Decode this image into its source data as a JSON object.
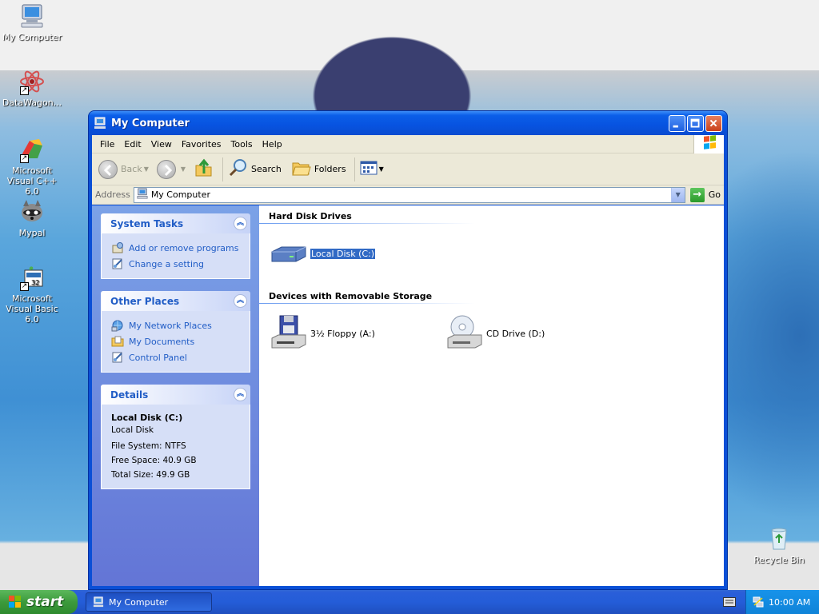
{
  "desktop": {
    "icons": [
      {
        "label": "My Computer"
      },
      {
        "label": "DataWagon..."
      },
      {
        "label": "Microsoft Visual C++ 6.0"
      },
      {
        "label": "Mypal"
      },
      {
        "label": "Microsoft Visual Basic 6.0"
      },
      {
        "label": "Recycle Bin"
      }
    ]
  },
  "window": {
    "title": "My Computer",
    "menu": [
      "File",
      "Edit",
      "View",
      "Favorites",
      "Tools",
      "Help"
    ],
    "toolbar": {
      "back": "Back",
      "search": "Search",
      "folders": "Folders"
    },
    "address": {
      "label": "Address",
      "value": "My Computer",
      "go": "Go"
    }
  },
  "sidebar": {
    "system_tasks": {
      "title": "System Tasks",
      "items": [
        "Add or remove programs",
        "Change a setting"
      ]
    },
    "other_places": {
      "title": "Other Places",
      "items": [
        "My Network Places",
        "My Documents",
        "Control Panel"
      ]
    },
    "details": {
      "title": "Details",
      "name": "Local Disk (C:)",
      "type": "Local Disk",
      "file_system": "File System: NTFS",
      "free_space": "Free Space: 40.9 GB",
      "total_size": "Total Size: 49.9 GB"
    }
  },
  "main": {
    "hard_disks": {
      "title": "Hard Disk Drives",
      "items": [
        "Local Disk (C:)"
      ]
    },
    "removable": {
      "title": "Devices with Removable Storage",
      "items": [
        "3½ Floppy (A:)",
        "CD Drive (D:)"
      ]
    }
  },
  "taskbar": {
    "start": "start",
    "active_task": "My Computer",
    "clock": "10:00 AM"
  },
  "colors": {
    "xp_blue": "#0a4fd6",
    "sidebar_link": "#215dc6",
    "selection": "#316ac5",
    "start_green": "#3c9a3c"
  }
}
